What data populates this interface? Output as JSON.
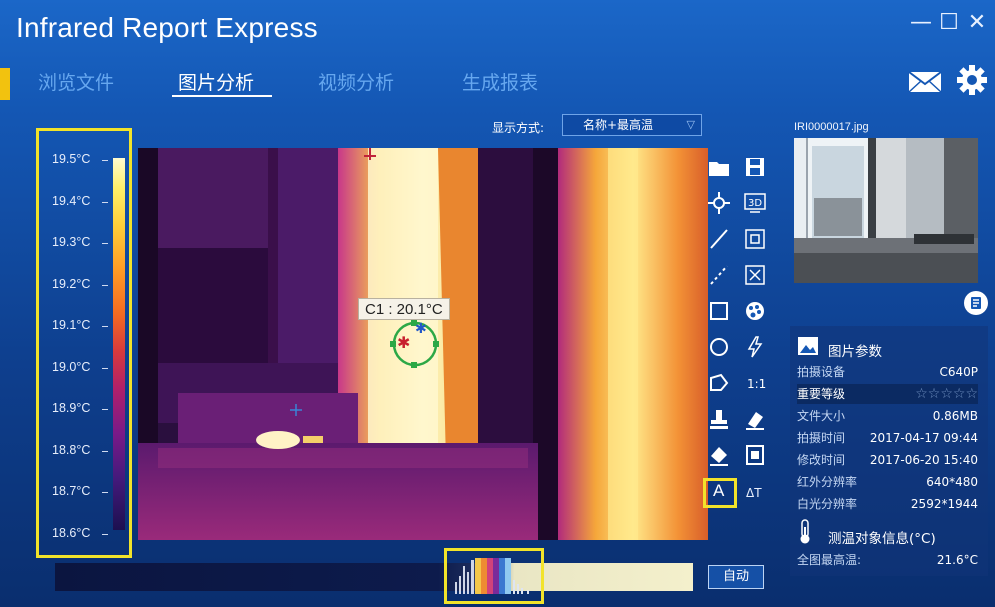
{
  "window": {
    "title": "Infrared Report Express",
    "controls": [
      "—",
      "☐",
      "✕"
    ]
  },
  "nav": {
    "tabs": [
      {
        "label": "浏览文件",
        "active": false
      },
      {
        "label": "图片分析",
        "active": true
      },
      {
        "label": "视频分析",
        "active": false
      },
      {
        "label": "生成报表",
        "active": false
      }
    ],
    "icons": [
      "mail-icon",
      "gear-icon"
    ]
  },
  "display_mode": {
    "label": "显示方式:",
    "selected": "名称+最高温"
  },
  "scale": {
    "ticks": [
      "19.5°C",
      "19.4°C",
      "19.3°C",
      "19.2°C",
      "19.1°C",
      "19.0°C",
      "18.9°C",
      "18.8°C",
      "18.7°C",
      "18.6°C"
    ]
  },
  "image": {
    "c1_label": "C1 : 20.1°C"
  },
  "tools": {
    "icons": [
      "open-folder-icon",
      "save-icon",
      "crosshair-point-icon",
      "3d-view-icon",
      "line-icon",
      "copy-icon",
      "dashed-line-icon",
      "clear-icon",
      "rectangle-icon",
      "palette-icon",
      "circle-icon",
      "lightning-icon",
      "polygon-icon",
      "ratio-icon",
      "level-tool-icon",
      "eraser-icon",
      "fill-icon",
      "export-icon",
      "text-icon",
      "delta-t-icon"
    ],
    "text_tool_label": "A",
    "delta_t_label": "ΔT"
  },
  "histogram": {
    "auto_button": "自动"
  },
  "right_panel": {
    "filename": "IRI0000017.jpg",
    "params_title": "图片参数",
    "params": [
      {
        "key": "拍摄设备",
        "value": "C640P"
      },
      {
        "key": "重要等级",
        "value": "☆☆☆☆☆"
      },
      {
        "key": "文件大小",
        "value": "0.86MB"
      },
      {
        "key": "拍摄时间",
        "value": "2017-04-17 09:44"
      },
      {
        "key": "修改时间",
        "value": "2017-06-20 15:40"
      },
      {
        "key": "红外分辨率",
        "value": "640*480"
      },
      {
        "key": "白光分辨率",
        "value": "2592*1944"
      }
    ],
    "temp_title": "测温对象信息(°C)",
    "max_temp": {
      "key": "全图最高温:",
      "value": "21.6°C"
    }
  },
  "colors": {
    "highlight": "#f2e32a",
    "nav_accent": "#f2c20f",
    "inactive_tab": "#66a7ef"
  }
}
